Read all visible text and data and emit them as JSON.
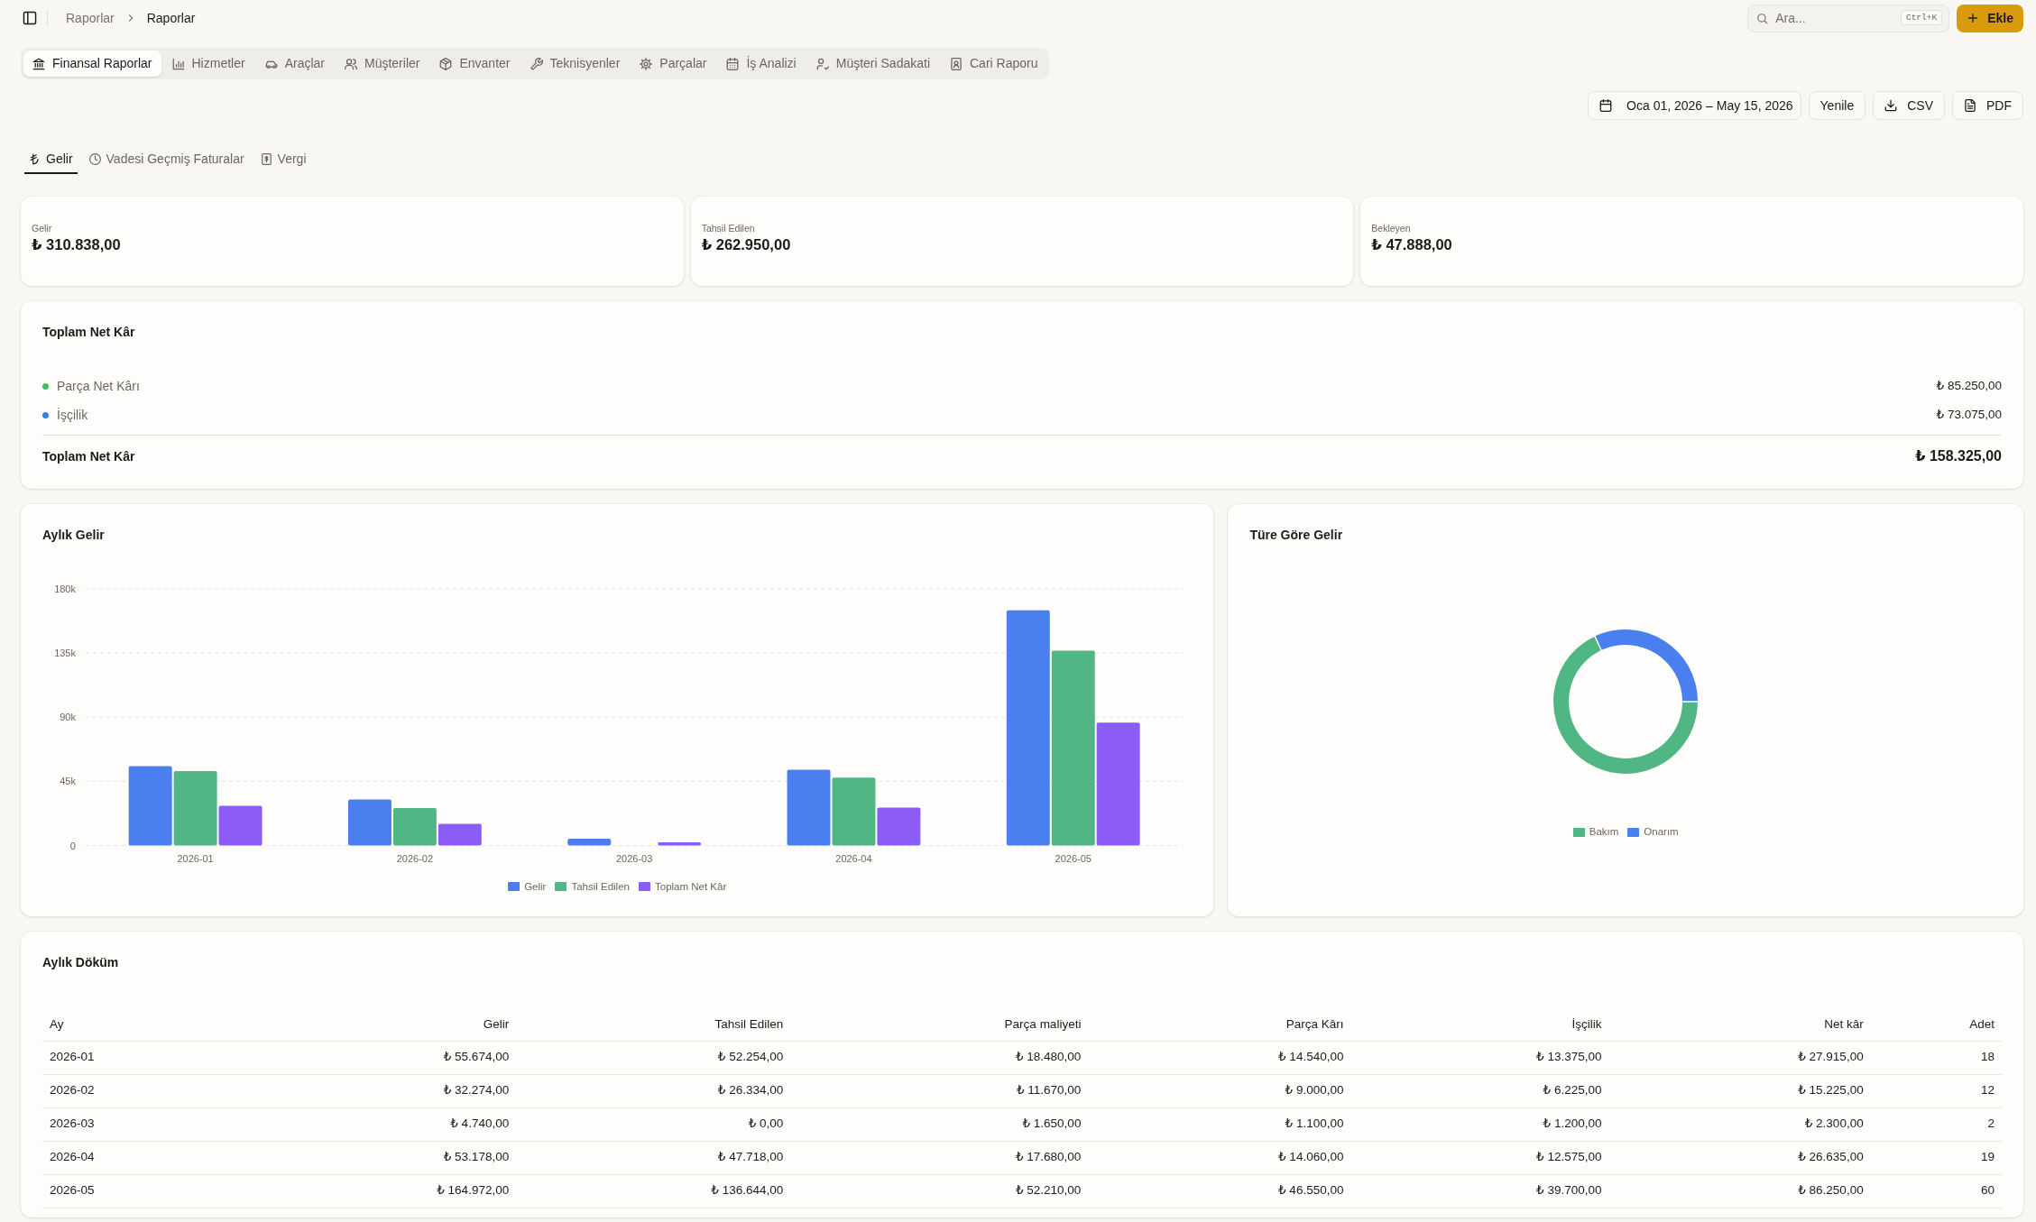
{
  "topbar": {
    "breadcrumb": [
      "Raporlar",
      "Raporlar"
    ],
    "search": {
      "placeholder": "Ara...",
      "shortcut": "Ctrl+K"
    },
    "add_button": "Ekle"
  },
  "report_tabs": [
    {
      "label": "Finansal Raporlar",
      "selected": true
    },
    {
      "label": "Hizmetler",
      "selected": false
    },
    {
      "label": "Araçlar",
      "selected": false
    },
    {
      "label": "Müşteriler",
      "selected": false
    },
    {
      "label": "Envanter",
      "selected": false
    },
    {
      "label": "Teknisyenler",
      "selected": false
    },
    {
      "label": "Parçalar",
      "selected": false
    },
    {
      "label": "İş Analizi",
      "selected": false
    },
    {
      "label": "Müşteri Sadakati",
      "selected": false
    },
    {
      "label": "Cari Raporu",
      "selected": false
    }
  ],
  "toolbar": {
    "date_range": "Oca 01, 2026 – May 15, 2026",
    "refresh": "Yenile",
    "csv": "CSV",
    "pdf": "PDF"
  },
  "section_tabs": [
    {
      "label": "Gelir",
      "selected": true
    },
    {
      "label": "Vadesi Geçmiş Faturalar",
      "selected": false
    },
    {
      "label": "Vergi",
      "selected": false
    }
  ],
  "summary_cards": [
    {
      "label": "Gelir",
      "value": "₺ 310.838,00"
    },
    {
      "label": "Tahsil Edilen",
      "value": "₺ 262.950,00"
    },
    {
      "label": "Bekleyen",
      "value": "₺ 47.888,00"
    }
  ],
  "net_profit": {
    "title": "Toplam Net Kâr",
    "items": [
      {
        "label": "Parça Net Kârı",
        "value": "₺ 85.250,00",
        "color": "#3fbf5f"
      },
      {
        "label": "İşçilik",
        "value": "₺ 73.075,00",
        "color": "#3b7de0"
      }
    ],
    "total_label": "Toplam Net Kâr",
    "total_value": "₺ 158.325,00"
  },
  "monthly_chart": {
    "title": "Aylık Gelir",
    "chart_data": {
      "type": "bar",
      "categories": [
        "2026-01",
        "2026-02",
        "2026-03",
        "2026-04",
        "2026-05"
      ],
      "series": [
        {
          "name": "Gelir",
          "color": "#4a7ff0",
          "values": [
            55674,
            32274,
            4740,
            53178,
            164972
          ]
        },
        {
          "name": "Tahsil Edilen",
          "color": "#50b683",
          "values": [
            52254,
            26334,
            0,
            47718,
            136644
          ]
        },
        {
          "name": "Toplam Net Kâr",
          "color": "#8b5cf6",
          "values": [
            27915,
            15225,
            2300,
            26635,
            86250
          ]
        }
      ],
      "ylim": [
        0,
        180000
      ],
      "yticks": [
        {
          "value": 0,
          "label": "0"
        },
        {
          "value": 45000,
          "label": "45k"
        },
        {
          "value": 90000,
          "label": "90k"
        },
        {
          "value": 135000,
          "label": "135k"
        },
        {
          "value": 180000,
          "label": "180k"
        }
      ],
      "grid": true,
      "legend": "bottom"
    }
  },
  "type_chart": {
    "title": "Türe Göre Gelir",
    "chart_data": {
      "type": "donut",
      "categories": [
        "Bakım",
        "Onarım"
      ],
      "values": [
        68,
        32
      ],
      "colors": [
        "#50b683",
        "#4a7ff0"
      ],
      "legend": "bottom"
    }
  },
  "monthly_table": {
    "title": "Aylık Döküm",
    "columns": [
      "Ay",
      "Gelir",
      "Tahsil Edilen",
      "Parça maliyeti",
      "Parça Kârı",
      "İşçilik",
      "Net kâr",
      "Adet"
    ],
    "rows": [
      [
        "2026-01",
        "₺ 55.674,00",
        "₺ 52.254,00",
        "₺ 18.480,00",
        "₺ 14.540,00",
        "₺ 13.375,00",
        "₺ 27.915,00",
        "18"
      ],
      [
        "2026-02",
        "₺ 32.274,00",
        "₺ 26.334,00",
        "₺ 11.670,00",
        "₺ 9.000,00",
        "₺ 6.225,00",
        "₺ 15.225,00",
        "12"
      ],
      [
        "2026-03",
        "₺ 4.740,00",
        "₺ 0,00",
        "₺ 1.650,00",
        "₺ 1.100,00",
        "₺ 1.200,00",
        "₺ 2.300,00",
        "2"
      ],
      [
        "2026-04",
        "₺ 53.178,00",
        "₺ 47.718,00",
        "₺ 17.680,00",
        "₺ 14.060,00",
        "₺ 12.575,00",
        "₺ 26.635,00",
        "19"
      ],
      [
        "2026-05",
        "₺ 164.972,00",
        "₺ 136.644,00",
        "₺ 52.210,00",
        "₺ 46.550,00",
        "₺ 39.700,00",
        "₺ 86.250,00",
        "60"
      ]
    ]
  }
}
